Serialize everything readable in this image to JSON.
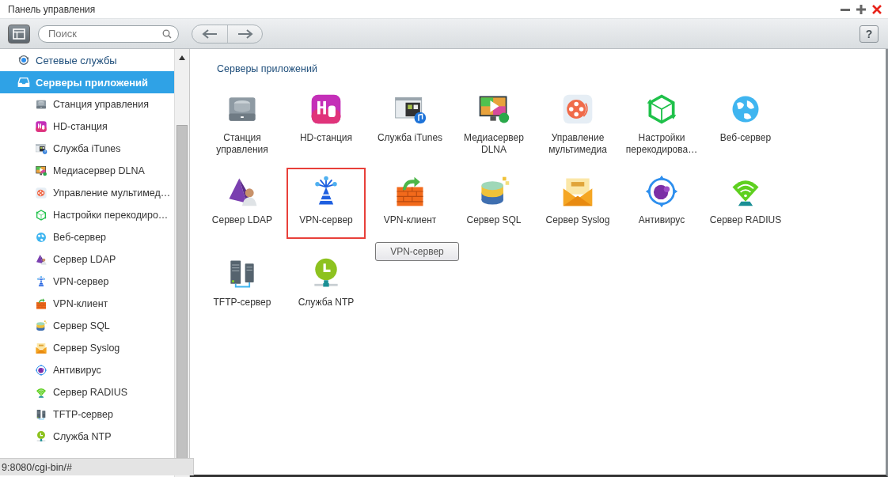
{
  "window": {
    "title": "Панель управления"
  },
  "toolbar": {
    "search": {
      "placeholder": "Поиск"
    },
    "help": "?"
  },
  "sidebar": {
    "items": [
      {
        "label": "Сетевые службы",
        "selected": false
      },
      {
        "label": "Серверы приложений",
        "selected": true,
        "children": [
          {
            "label": "Станция управления",
            "selected": false
          },
          {
            "label": "HD-станция",
            "selected": false
          },
          {
            "label": "Служба iTunes",
            "selected": false
          },
          {
            "label": "Медиасервер DLNA",
            "selected": false
          },
          {
            "label": "Управление мультимед…",
            "selected": false
          },
          {
            "label": "Настройки перекодиро…",
            "selected": false
          },
          {
            "label": "Веб-сервер",
            "selected": false
          },
          {
            "label": "Сервер LDAP",
            "selected": false
          },
          {
            "label": "VPN-сервер",
            "selected": false
          },
          {
            "label": "VPN-клиент",
            "selected": false
          },
          {
            "label": "Сервер SQL",
            "selected": false
          },
          {
            "label": "Сервер Syslog",
            "selected": false
          },
          {
            "label": "Антивирус",
            "selected": false
          },
          {
            "label": "Сервер RADIUS",
            "selected": false
          },
          {
            "label": "TFTP-сервер",
            "selected": false
          },
          {
            "label": "Служба NTP",
            "selected": false
          }
        ]
      }
    ]
  },
  "content": {
    "heading": "Серверы приложений",
    "apps": [
      {
        "label": "Станция управления",
        "selected": false
      },
      {
        "label": "HD-станция",
        "selected": false
      },
      {
        "label": "Служба iTunes",
        "selected": false
      },
      {
        "label": "Медиасервер DLNA",
        "selected": false
      },
      {
        "label": "Управление мультимедиа",
        "selected": false
      },
      {
        "label": "Настройки перекодирова…",
        "selected": false
      },
      {
        "label": "Веб-сервер",
        "selected": false
      },
      {
        "label": "Сервер LDAP",
        "selected": false
      },
      {
        "label": "VPN-сервер",
        "selected": true
      },
      {
        "label": "VPN-клиент",
        "selected": false
      },
      {
        "label": "Сервер SQL",
        "selected": false
      },
      {
        "label": "Сервер Syslog",
        "selected": false
      },
      {
        "label": "Антивирус",
        "selected": false
      },
      {
        "label": "Сервер RADIUS",
        "selected": false
      },
      {
        "label": "TFTP-сервер",
        "selected": false
      },
      {
        "label": "Служба NTP",
        "selected": false
      }
    ],
    "tooltip": "VPN-сервер"
  },
  "status_bar": {
    "text": "9:8080/cgi-bin/#"
  }
}
